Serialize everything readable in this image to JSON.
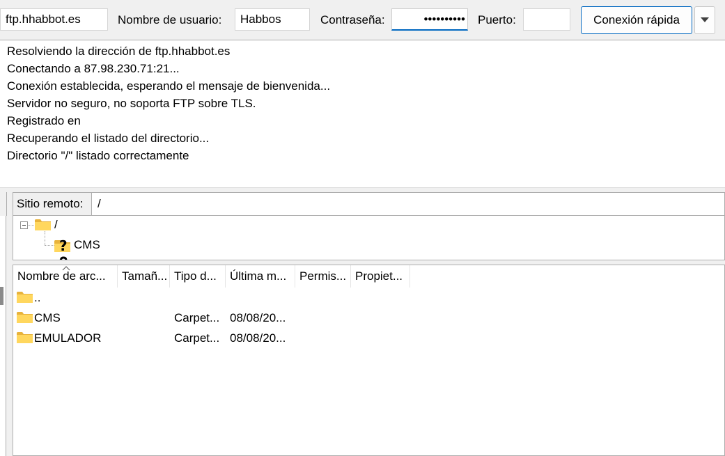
{
  "quickconnect": {
    "host_value": "ftp.hhabbot.es",
    "username_label": "Nombre de usuario:",
    "username_value": "Habbos",
    "password_label": "Contraseña:",
    "password_value": "••••••••••",
    "port_label": "Puerto:",
    "port_value": "",
    "connect_button": "Conexión rápida"
  },
  "log": [
    "Resolviendo la dirección de ftp.hhabbot.es",
    "Conectando a 87.98.230.71:21...",
    "Conexión establecida, esperando el mensaje de bienvenida...",
    "Servidor no seguro, no soporta FTP sobre TLS.",
    "Registrado en",
    "Recuperando el listado del directorio...",
    "Directorio \"/\" listado correctamente"
  ],
  "remote": {
    "label": "Sitio remoto:",
    "path": "/"
  },
  "tree": {
    "root": "/",
    "children": [
      "CMS"
    ]
  },
  "filelist": {
    "columns": [
      "Nombre de arc...",
      "Tamañ...",
      "Tipo d...",
      "Última m...",
      "Permis...",
      "Propiet..."
    ],
    "rows": [
      {
        "name": "..",
        "size": "",
        "type": "",
        "modified": "",
        "perms": "",
        "owner": ""
      },
      {
        "name": "CMS",
        "size": "",
        "type": "Carpet...",
        "modified": "08/08/20...",
        "perms": "",
        "owner": ""
      },
      {
        "name": "EMULADOR",
        "size": "",
        "type": "Carpet...",
        "modified": "08/08/20...",
        "perms": "",
        "owner": ""
      }
    ]
  },
  "colors": {
    "accent": "#0067c0",
    "folder": "#ffd75e",
    "folder_dark": "#e8b33c"
  }
}
